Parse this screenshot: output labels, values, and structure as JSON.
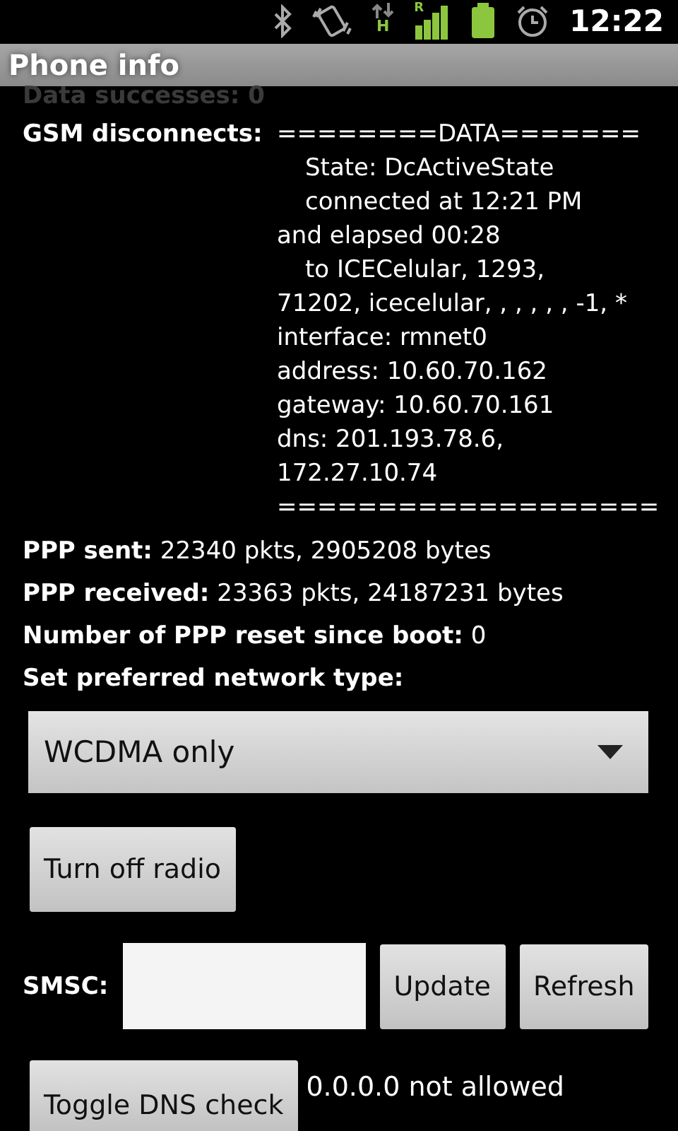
{
  "status_bar": {
    "network_type": "H",
    "roaming": "R",
    "time": "12:22"
  },
  "title": "Phone info",
  "faded_row": {
    "label": "Data successes:",
    "value": "0"
  },
  "data_row": {
    "label": "GSM disconnects:",
    "lines": [
      {
        "text": "========DATA=======",
        "indented": false
      },
      {
        "text": "State: DcActiveState",
        "indented": true
      },
      {
        "text": "connected at 12:21 PM",
        "indented": true
      },
      {
        "text": "and elapsed 00:28",
        "indented": false
      },
      {
        "text": "to ICECelular, 1293,",
        "indented": true
      },
      {
        "text": "71202, icecelular, , , , , , -1, *",
        "indented": false
      },
      {
        "text": "interface: rmnet0",
        "indented": false
      },
      {
        "text": "address: 10.60.70.162",
        "indented": false
      },
      {
        "text": "gateway: 10.60.70.161",
        "indented": false
      },
      {
        "text": "dns: 201.193.78.6,",
        "indented": false
      },
      {
        "text": "172.27.10.74",
        "indented": false
      },
      {
        "text": "===================",
        "indented": false
      }
    ]
  },
  "stats": [
    {
      "label": "PPP sent:",
      "value": "22340 pkts, 2905208 bytes"
    },
    {
      "label": "PPP received:",
      "value": "23363 pkts, 24187231 bytes"
    },
    {
      "label": "Number of PPP reset since boot:",
      "value": "0"
    }
  ],
  "network_type": {
    "label": "Set preferred network type:",
    "value": "WCDMA only"
  },
  "radio_button": "Turn off radio",
  "smsc": {
    "label": "SMSC:",
    "buttons": [
      "Update",
      "Refresh"
    ]
  },
  "dns": {
    "button": "Toggle DNS check",
    "status": "0.0.0.0 not allowed"
  }
}
